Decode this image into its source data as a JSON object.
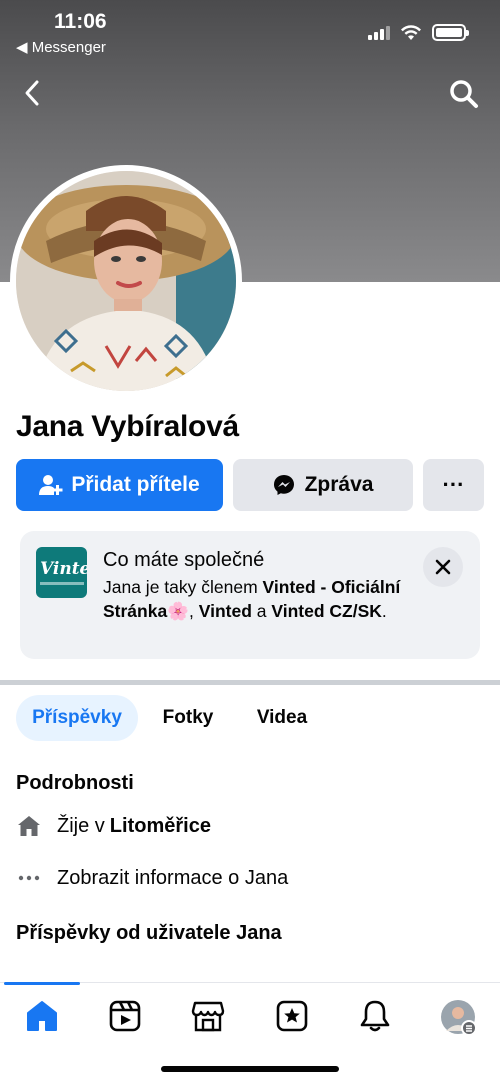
{
  "status": {
    "time": "11:06",
    "back_app": "◀ Messenger"
  },
  "profile": {
    "name": "Jana Vybíralová"
  },
  "actions": {
    "add_friend": "Přidat přítele",
    "message": "Zpráva",
    "more": "···"
  },
  "common_card": {
    "title": "Co máte společné",
    "text_part1": "Jana je taky členem ",
    "group1": "Vinted - Oficiální Stránka",
    "emoji": "🌸",
    "text_part2": ", ",
    "group2": "Vinted",
    "text_part3": " a ",
    "group3": "Vinted CZ/SK",
    "text_part4": ".",
    "logo_text": "Vinted"
  },
  "tabs": {
    "posts": "Příspěvky",
    "photos": "Fotky",
    "videos": "Videa"
  },
  "details": {
    "title": "Podrobnosti",
    "lives_prefix": "Žije v ",
    "lives_city": "Litoměřice",
    "show_info": "Zobrazit informace o Jana"
  },
  "posts_section": {
    "title": "Příspěvky od uživatele Jana"
  },
  "colors": {
    "accent": "#1877f2",
    "button_gray": "#e4e6eb",
    "card_bg": "#f0f2f5",
    "vinted_teal": "#0e7a7a"
  },
  "icons": {
    "back": "chevron-left-icon",
    "search": "search-icon",
    "add_friend": "person-add-icon",
    "messenger": "messenger-icon",
    "close": "close-icon",
    "home": "house-icon",
    "more": "more-dots-icon",
    "tabbar": [
      "home-icon",
      "video-icon",
      "marketplace-icon",
      "groups-icon",
      "notifications-icon",
      "profile-menu-icon"
    ]
  }
}
